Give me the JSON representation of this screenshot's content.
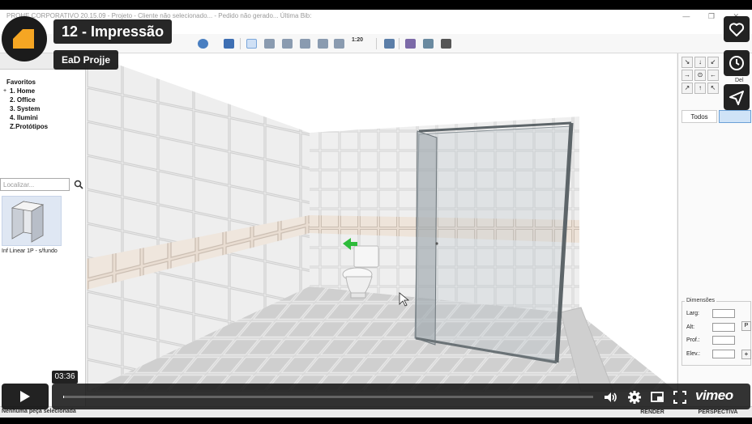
{
  "app": {
    "window_title": "PROHE CORPORATIVO 20.15.09 - Projeto - Cliente não selecionado... - Pedido não gerado... Última Bib:",
    "toolbar": {
      "scale": "1:20"
    },
    "library": {
      "tree": [
        {
          "label": "Favoritos",
          "level": 0,
          "expander": ""
        },
        {
          "label": "1. Home",
          "level": 1,
          "expander": "+"
        },
        {
          "label": "2. Office",
          "level": 1,
          "expander": ""
        },
        {
          "label": "3. System",
          "level": 1,
          "expander": ""
        },
        {
          "label": "4. Ilumini",
          "level": 1,
          "expander": ""
        },
        {
          "label": "Z.Protótipos",
          "level": 1,
          "expander": ""
        }
      ],
      "search_placeholder": "Localizar...",
      "item_label": "Inf Linear 1P - s/fundo"
    },
    "right_panel": {
      "nav_buttons": [
        "↘",
        "↓",
        "↙",
        "→",
        "⊙",
        "←",
        "↗",
        "↑",
        "↖"
      ],
      "delete_label": "Del",
      "tab_all": "Todos",
      "dimensions": {
        "title": "Dimensões",
        "width_label": "Larg:",
        "height_label": "Alt:",
        "depth_label": "Prof.:",
        "elevation_label": "Elev.:",
        "p_button": "P",
        "plus_button": "+"
      }
    },
    "status": {
      "text": "Nenhuma peça selecionada",
      "render_button": "RENDER",
      "perspective_button": "PERSPECTIVA"
    }
  },
  "player": {
    "title": "12 - Impressão",
    "byline": "EaD Projje",
    "time_tooltip": "03:36",
    "progress": 0.001,
    "logo": "vimeo",
    "side_buttons": [
      "heart-icon",
      "clock-icon",
      "send-icon"
    ],
    "colors": {
      "accent": "#f5a623",
      "overlay": "#0f0f0f"
    }
  }
}
